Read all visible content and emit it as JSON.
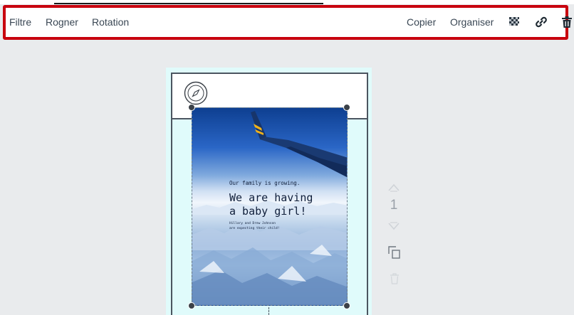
{
  "toolbar": {
    "left_items": [
      {
        "label": "Filtre"
      },
      {
        "label": "Rogner"
      },
      {
        "label": "Rotation"
      }
    ],
    "right_items": [
      {
        "label": "Copier"
      },
      {
        "label": "Organiser"
      }
    ],
    "icons": [
      "transparency-icon",
      "link-icon",
      "trash-icon"
    ],
    "highlight_color": "#c8000e"
  },
  "design": {
    "small_heading": "Our family is growing.",
    "big_heading_line1": "We are having",
    "big_heading_line2": "a baby girl!",
    "body_line1": "Hillary and Drew Johnson",
    "body_line2": "are expecting their child!"
  },
  "page_controls": {
    "page_number": "1",
    "icons": [
      "chevron-up-icon",
      "chevron-down-icon",
      "duplicate-page-icon",
      "delete-page-icon"
    ]
  }
}
